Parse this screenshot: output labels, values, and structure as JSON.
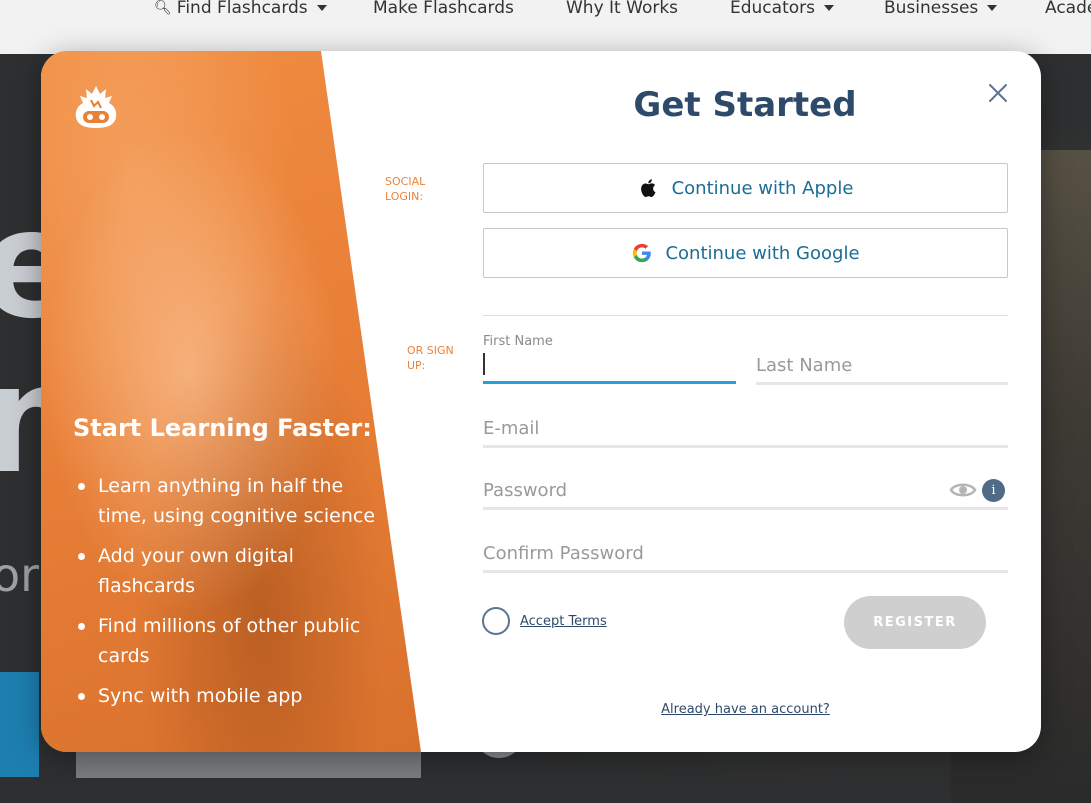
{
  "nav": {
    "items": [
      {
        "label": "Find Flashcards",
        "has_search_icon": true,
        "has_caret": true
      },
      {
        "label": "Make Flashcards",
        "has_caret": false
      },
      {
        "label": "Why It Works",
        "has_caret": false
      },
      {
        "label": "Educators",
        "has_caret": true
      },
      {
        "label": "Businesses",
        "has_caret": true
      },
      {
        "label": "Acade",
        "has_caret": false
      }
    ]
  },
  "background": {
    "letters": [
      "e",
      "n",
      "or"
    ]
  },
  "promo": {
    "heading": "Start Learning Faster:",
    "bullets": [
      "Learn anything in half the time, using cognitive science",
      "Add your own digital flashcards",
      "Find millions of other public cards",
      "Sync with mobile app"
    ],
    "logo_icon": "brainscape-logo-icon"
  },
  "modal": {
    "title": "Get Started",
    "social_label": "SOCIAL LOGIN:",
    "signup_label": "OR SIGN UP:",
    "apple_button": "Continue with Apple",
    "google_button": "Continue with Google",
    "fields": {
      "first_name_label": "First Name",
      "first_name_value": "",
      "last_name_placeholder": "Last Name",
      "email_placeholder": "E-mail",
      "password_placeholder": "Password",
      "confirm_password_placeholder": "Confirm Password"
    },
    "info_glyph": "i",
    "accept_terms": "Accept Terms",
    "register_button": "REGISTER",
    "already_account": "Already have an account?",
    "colors": {
      "title": "#2e4a6b",
      "accent_orange": "#e8833a",
      "link_blue": "#1b6d96",
      "active_underline": "#27a0d8",
      "register_disabled": "#cfcfcf"
    }
  }
}
